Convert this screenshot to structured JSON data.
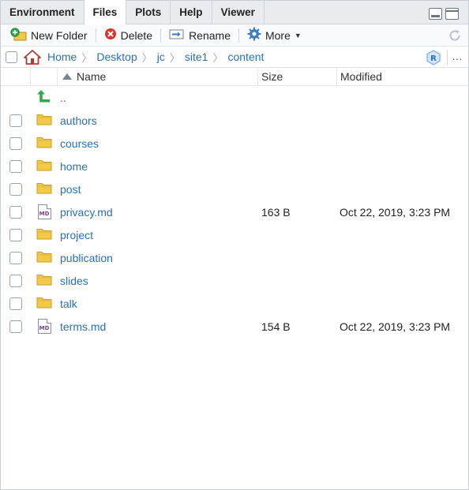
{
  "tabs": [
    {
      "label": "Environment",
      "active": false
    },
    {
      "label": "Files",
      "active": true
    },
    {
      "label": "Plots",
      "active": false
    },
    {
      "label": "Help",
      "active": false
    },
    {
      "label": "Viewer",
      "active": false
    }
  ],
  "toolbar": {
    "new_folder": "New Folder",
    "delete": "Delete",
    "rename": "Rename",
    "more": "More"
  },
  "breadcrumb": {
    "items": [
      "Home",
      "Desktop",
      "jc",
      "site1",
      "content"
    ],
    "more": "…"
  },
  "table": {
    "headers": {
      "name": "Name",
      "size": "Size",
      "modified": "Modified"
    },
    "parent": "..",
    "rows": [
      {
        "type": "folder",
        "name": "authors",
        "size": "",
        "modified": ""
      },
      {
        "type": "folder",
        "name": "courses",
        "size": "",
        "modified": ""
      },
      {
        "type": "folder",
        "name": "home",
        "size": "",
        "modified": ""
      },
      {
        "type": "folder",
        "name": "post",
        "size": "",
        "modified": ""
      },
      {
        "type": "md",
        "name": "privacy.md",
        "size": "163 B",
        "modified": "Oct 22, 2019, 3:23 PM"
      },
      {
        "type": "folder",
        "name": "project",
        "size": "",
        "modified": ""
      },
      {
        "type": "folder",
        "name": "publication",
        "size": "",
        "modified": ""
      },
      {
        "type": "folder",
        "name": "slides",
        "size": "",
        "modified": ""
      },
      {
        "type": "folder",
        "name": "talk",
        "size": "",
        "modified": ""
      },
      {
        "type": "md",
        "name": "terms.md",
        "size": "154 B",
        "modified": "Oct 22, 2019, 3:23 PM"
      }
    ]
  },
  "icons": {
    "folder": "folder-icon",
    "md": "md-file-icon",
    "md_label": "MD",
    "up": "parent-dir-icon"
  },
  "colors": {
    "link": "#2a6fbe",
    "folder": "#f3c94a",
    "accent_green": "#2fa84f"
  }
}
